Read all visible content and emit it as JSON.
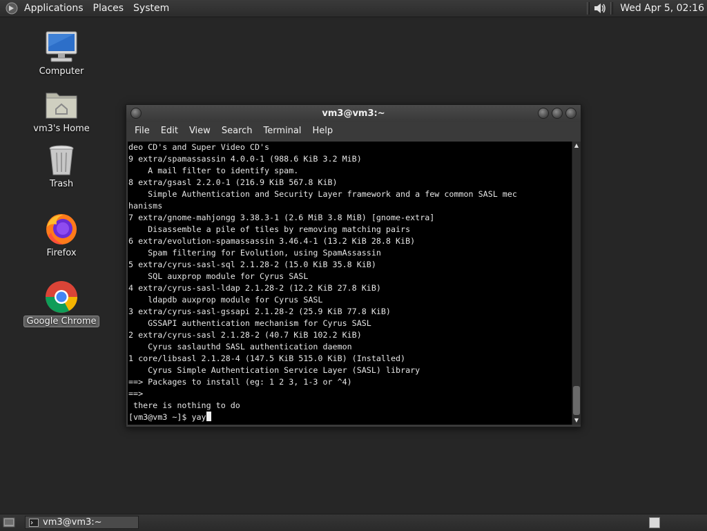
{
  "top_panel": {
    "logo_icon": "distributor-logo-icon",
    "menus": [
      "Applications",
      "Places",
      "System"
    ],
    "volume_icon": "volume-icon",
    "clock": "Wed Apr  5, 02:16"
  },
  "desktop_icons": [
    {
      "label": "Computer",
      "icon": "computer-icon"
    },
    {
      "label": "vm3's Home",
      "icon": "home-folder-icon"
    },
    {
      "label": "Trash",
      "icon": "trash-icon"
    },
    {
      "label": "Firefox",
      "icon": "firefox-icon"
    },
    {
      "label": "Google Chrome",
      "icon": "chrome-icon"
    }
  ],
  "terminal": {
    "title": "vm3@vm3:~",
    "menu": [
      "File",
      "Edit",
      "View",
      "Search",
      "Terminal",
      "Help"
    ],
    "lines": [
      "deo CD's and Super Video CD's",
      "9 extra/spamassassin 4.0.0-1 (988.6 KiB 3.2 MiB)",
      "    A mail filter to identify spam.",
      "8 extra/gsasl 2.2.0-1 (216.9 KiB 567.8 KiB)",
      "    Simple Authentication and Security Layer framework and a few common SASL mec",
      "hanisms",
      "7 extra/gnome-mahjongg 3.38.3-1 (2.6 MiB 3.8 MiB) [gnome-extra]",
      "    Disassemble a pile of tiles by removing matching pairs",
      "6 extra/evolution-spamassassin 3.46.4-1 (13.2 KiB 28.8 KiB)",
      "    Spam filtering for Evolution, using SpamAssassin",
      "5 extra/cyrus-sasl-sql 2.1.28-2 (15.0 KiB 35.8 KiB)",
      "    SQL auxprop module for Cyrus SASL",
      "4 extra/cyrus-sasl-ldap 2.1.28-2 (12.2 KiB 27.8 KiB)",
      "    ldapdb auxprop module for Cyrus SASL",
      "3 extra/cyrus-sasl-gssapi 2.1.28-2 (25.9 KiB 77.8 KiB)",
      "    GSSAPI authentication mechanism for Cyrus SASL",
      "2 extra/cyrus-sasl 2.1.28-2 (40.7 KiB 102.2 KiB)",
      "    Cyrus saslauthd SASL authentication daemon",
      "1 core/libsasl 2.1.28-4 (147.5 KiB 515.0 KiB) (Installed)",
      "    Cyrus Simple Authentication Service Layer (SASL) library",
      "==> Packages to install (eg: 1 2 3, 1-3 or ^4)",
      "==>",
      " there is nothing to do"
    ],
    "prompt": "[vm3@vm3 ~]$ ",
    "input": "yay"
  },
  "bottom_panel": {
    "show_desktop_icon": "show-desktop-icon",
    "task_icon": "terminal-icon",
    "task_label": "vm3@vm3:~",
    "workspace_icon": "workspace-switcher-icon"
  }
}
